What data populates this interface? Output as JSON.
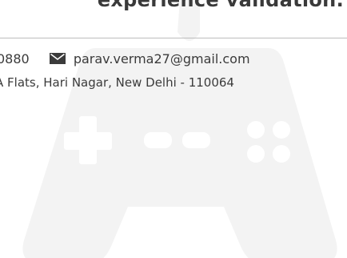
{
  "header": {
    "headline": "experience validation."
  },
  "contact": {
    "phone": "0880",
    "email": "parav.verma27@gmail.com",
    "email_icon": "envelope-icon",
    "address": "A Flats, Hari Nagar, New Delhi - 110064"
  },
  "watermark": {
    "icon": "gamepad-icon",
    "color": "#f3f3f3"
  }
}
